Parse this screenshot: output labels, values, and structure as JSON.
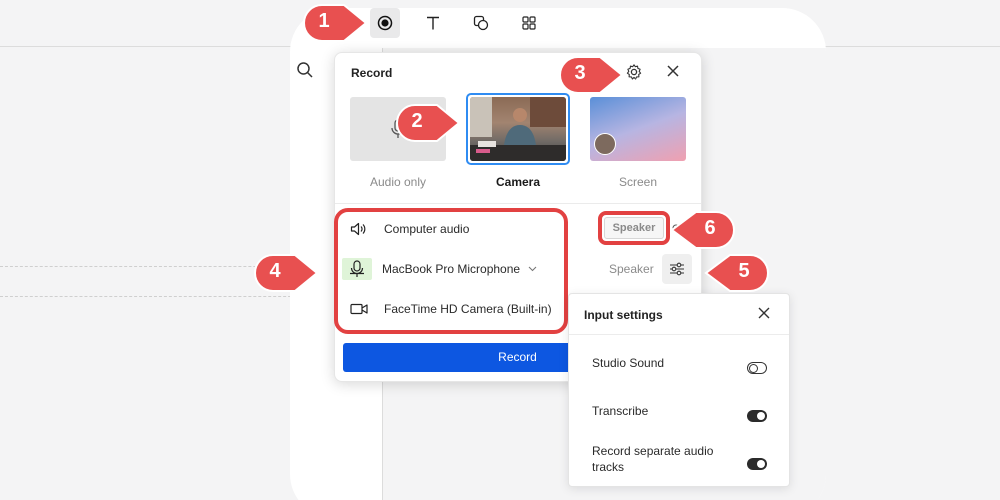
{
  "record_panel": {
    "title": "Record",
    "modes": [
      {
        "label": "Audio only"
      },
      {
        "label": "Camera"
      },
      {
        "label": "Screen"
      }
    ],
    "sources": [
      {
        "label": "Computer audio",
        "icon": "speaker-icon"
      },
      {
        "label": "MacBook Pro Microphone",
        "icon": "microphone-icon"
      },
      {
        "label": "FaceTime HD Camera (Built-in)",
        "icon": "video-camera-icon"
      }
    ],
    "speaker_button_label": "Speaker",
    "speaker_label": "Speaker",
    "record_button_label": "Record"
  },
  "input_settings": {
    "title": "Input settings",
    "options": [
      {
        "label": "Studio Sound",
        "enabled": false
      },
      {
        "label": "Transcribe",
        "enabled": true
      },
      {
        "label": "Record separate audio tracks",
        "enabled": true
      }
    ]
  },
  "callouts": [
    "1",
    "2",
    "3",
    "4",
    "5",
    "6"
  ],
  "colors": {
    "accent": "#0d57e1",
    "highlight": "#e24141",
    "selected_border": "#2f8cf2",
    "mic_level": "#dff4d8"
  }
}
